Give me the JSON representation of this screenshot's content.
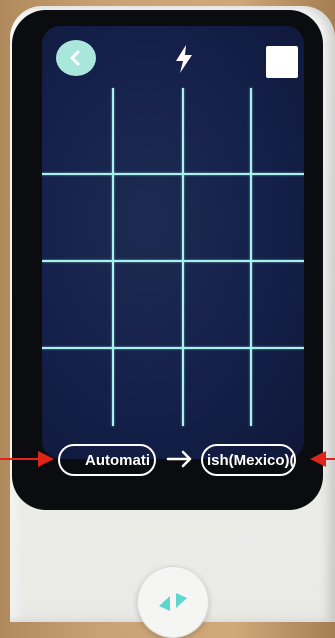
{
  "header": {
    "back_icon": "chevron-left-icon",
    "flash_icon": "lightning-bolt-icon",
    "capture_icon": "square-icon"
  },
  "language_bar": {
    "source_language": "Automati",
    "target_language": "ish(Mexico)(l",
    "swap_icon": "right-arrow-icon"
  },
  "device": {
    "home_icon": "bidirectional-arrows-icon"
  },
  "colors": {
    "accent": "#a9e7dc",
    "grid": "#a8f2ec",
    "screen_bg": "#14204a",
    "annotation": "#e0241b"
  }
}
